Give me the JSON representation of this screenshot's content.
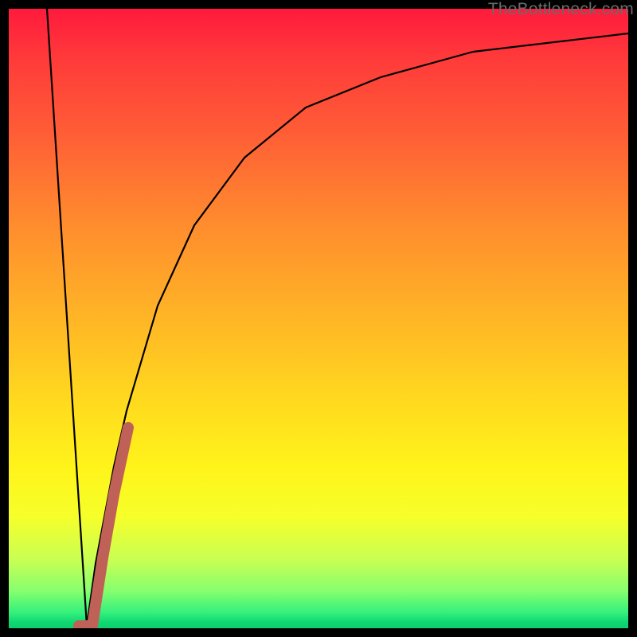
{
  "watermark": "TheBottleneck.com",
  "chart_data": {
    "type": "line",
    "title": "",
    "xlabel": "",
    "ylabel": "",
    "xlim": [
      0,
      100
    ],
    "ylim": [
      0,
      100
    ],
    "series": [
      {
        "name": "bottleneck-curve",
        "color": "#000000",
        "points": [
          {
            "x": 6.2,
            "y": 100
          },
          {
            "x": 12.6,
            "y": 0
          },
          {
            "x": 14.0,
            "y": 10
          },
          {
            "x": 17.0,
            "y": 26
          },
          {
            "x": 19.0,
            "y": 35
          },
          {
            "x": 24.0,
            "y": 52
          },
          {
            "x": 30.0,
            "y": 65
          },
          {
            "x": 38.0,
            "y": 76
          },
          {
            "x": 48.0,
            "y": 84
          },
          {
            "x": 60.0,
            "y": 89
          },
          {
            "x": 75.0,
            "y": 93
          },
          {
            "x": 100.0,
            "y": 96
          }
        ]
      },
      {
        "name": "highlight-segment",
        "color": "#c06158",
        "points": [
          {
            "x": 11.3,
            "y": 0
          },
          {
            "x": 13.5,
            "y": 0
          },
          {
            "x": 15.2,
            "y": 11
          },
          {
            "x": 17.0,
            "y": 21
          },
          {
            "x": 19.3,
            "y": 32
          }
        ]
      }
    ]
  }
}
